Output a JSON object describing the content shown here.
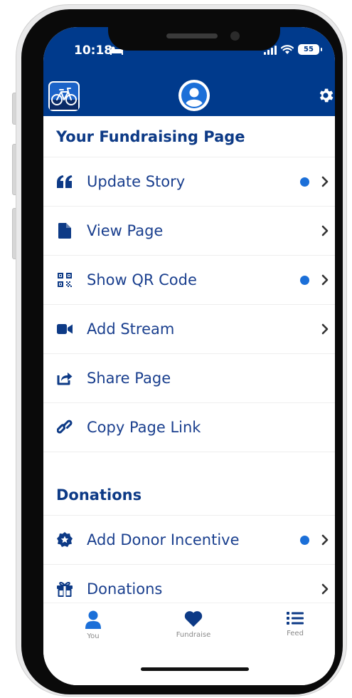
{
  "status_bar": {
    "time": "10:18",
    "battery": "55"
  },
  "sections": [
    {
      "title": "Your Fundraising Page",
      "items": [
        {
          "label": "Update Story",
          "icon": "quote-icon",
          "dot": true,
          "chevron": true
        },
        {
          "label": "View Page",
          "icon": "document-icon",
          "dot": false,
          "chevron": true
        },
        {
          "label": "Show QR Code",
          "icon": "qr-code-icon",
          "dot": true,
          "chevron": true
        },
        {
          "label": "Add Stream",
          "icon": "video-camera-icon",
          "dot": false,
          "chevron": true
        },
        {
          "label": "Share Page",
          "icon": "share-icon",
          "dot": false,
          "chevron": false
        },
        {
          "label": "Copy Page Link",
          "icon": "link-icon",
          "dot": false,
          "chevron": false
        }
      ]
    },
    {
      "title": "Donations",
      "items": [
        {
          "label": "Add Donor Incentive",
          "icon": "badge-star-icon",
          "dot": true,
          "chevron": true
        },
        {
          "label": "Donations",
          "icon": "gift-icon",
          "dot": false,
          "chevron": true
        }
      ]
    }
  ],
  "tabbar": {
    "tabs": [
      {
        "label": "You",
        "icon": "user-icon",
        "active": true
      },
      {
        "label": "Fundraise",
        "icon": "heart-icon",
        "active": false
      },
      {
        "label": "Feed",
        "icon": "list-icon",
        "active": false
      }
    ]
  },
  "colors": {
    "header": "#003a8c",
    "accent": "#1b6fd8",
    "text": "#1a3f8e",
    "title": "#0d3a86"
  }
}
